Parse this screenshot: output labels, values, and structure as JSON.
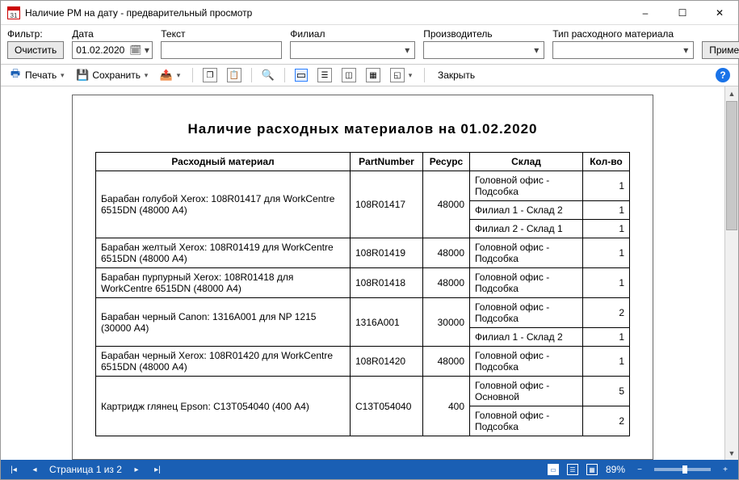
{
  "window": {
    "title": "Наличие РМ на дату - предварительный просмотр"
  },
  "filter": {
    "label": "Фильтр:",
    "clear": "Очистить",
    "date_label": "Дата",
    "date_value": "01.02.2020",
    "text_label": "Текст",
    "text_value": "",
    "branch_label": "Филиал",
    "branch_value": "",
    "vendor_label": "Производитель",
    "vendor_value": "",
    "type_label": "Тип расходного материала",
    "type_value": "",
    "apply": "Применить"
  },
  "toolbar": {
    "print": "Печать",
    "save": "Сохранить",
    "close": "Закрыть"
  },
  "report": {
    "title": "Наличие  расходных  материалов  на  01.02.2020",
    "headers": {
      "name": "Расходный материал",
      "partnumber": "PartNumber",
      "resource": "Ресурс",
      "warehouse": "Склад",
      "qty": "Кол-во"
    },
    "rows": [
      {
        "name": "Барабан голубой Xerox: 108R01417 для WorkCentre 6515DN (48000 А4)",
        "partnumber": "108R01417",
        "resource": "48000",
        "lines": [
          {
            "warehouse": "Головной офис - Подсобка",
            "qty": "1"
          },
          {
            "warehouse": "Филиал 1 - Склад 2",
            "qty": "1"
          },
          {
            "warehouse": "Филиал 2 - Склад 1",
            "qty": "1"
          }
        ]
      },
      {
        "name": "Барабан желтый Xerox: 108R01419 для WorkCentre 6515DN (48000 А4)",
        "partnumber": "108R01419",
        "resource": "48000",
        "lines": [
          {
            "warehouse": "Головной офис - Подсобка",
            "qty": "1"
          }
        ]
      },
      {
        "name": "Барабан пурпурный Xerox: 108R01418 для WorkCentre 6515DN (48000 А4)",
        "partnumber": "108R01418",
        "resource": "48000",
        "lines": [
          {
            "warehouse": "Головной офис - Подсобка",
            "qty": "1"
          }
        ]
      },
      {
        "name": "Барабан черный Canon: 1316A001 для NP 1215 (30000 А4)",
        "partnumber": "1316A001",
        "resource": "30000",
        "lines": [
          {
            "warehouse": "Головной офис - Подсобка",
            "qty": "2"
          },
          {
            "warehouse": "Филиал 1 - Склад 2",
            "qty": "1"
          }
        ]
      },
      {
        "name": "Барабан черный Xerox: 108R01420 для WorkCentre 6515DN (48000 А4)",
        "partnumber": "108R01420",
        "resource": "48000",
        "lines": [
          {
            "warehouse": "Головной офис - Подсобка",
            "qty": "1"
          }
        ]
      },
      {
        "name": "Картридж глянец Epson: C13T054040 (400 А4)",
        "partnumber": "C13T054040",
        "resource": "400",
        "lines": [
          {
            "warehouse": "Головной офис - Основной",
            "qty": "5"
          },
          {
            "warehouse": "Головной офис - Подсобка",
            "qty": "2"
          }
        ]
      }
    ]
  },
  "status": {
    "page_of": "Страница 1 из 2",
    "zoom": "89%"
  }
}
